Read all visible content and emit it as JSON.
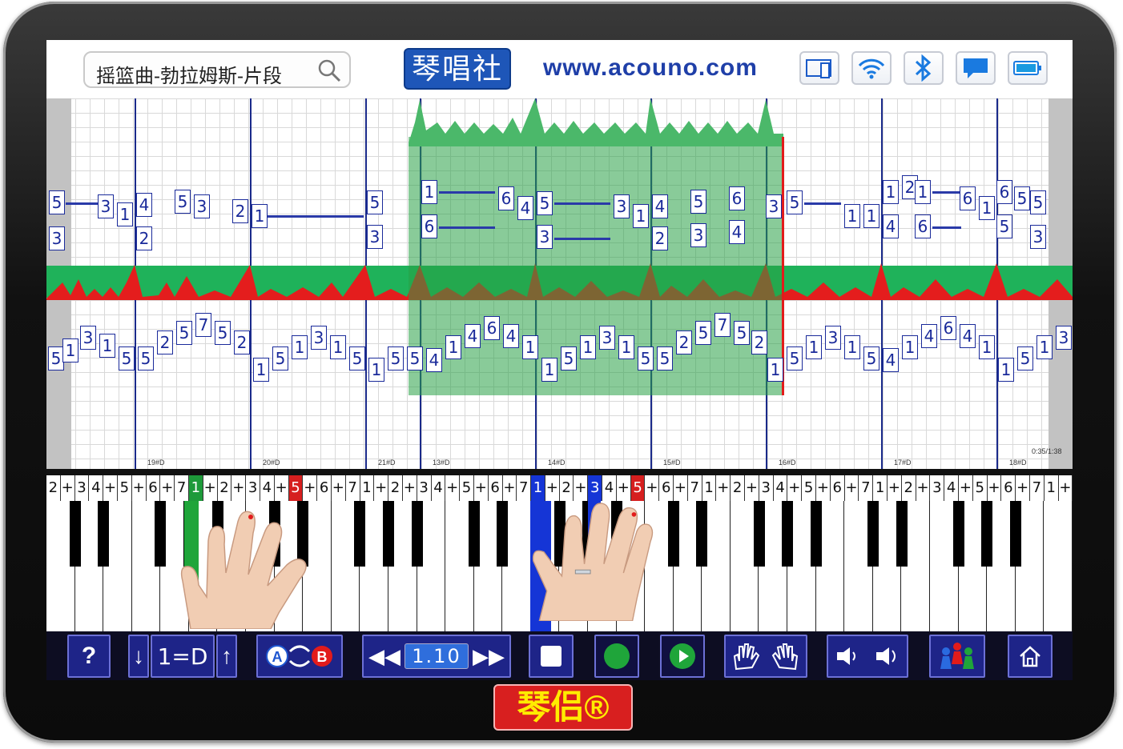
{
  "header": {
    "song_title": "摇篮曲-勃拉姆斯-片段",
    "brand_name": "琴唱社",
    "website": "www.acouno.com",
    "status_icons": [
      "screen-mirror-icon",
      "wifi-icon",
      "bluetooth-icon",
      "message-icon",
      "battery-icon"
    ]
  },
  "score": {
    "measure_labels": [
      "19#D",
      "20#D",
      "21#D",
      "13#D",
      "14#D",
      "15#D",
      "16#D",
      "17#D",
      "18#D"
    ],
    "time_readout": "0:35/1:38",
    "upper_notes": [
      "5",
      "3",
      "3",
      "1",
      "4",
      "2",
      "5",
      "4",
      "3",
      "2",
      "1",
      "5",
      "3",
      "1",
      "1",
      "6",
      "6",
      "4",
      "5",
      "3",
      "3",
      "1",
      "4",
      "2",
      "5",
      "3",
      "6",
      "4",
      "3",
      "5",
      "1",
      "1",
      "1",
      "2",
      "1",
      "6",
      "6",
      "6",
      "4",
      "1",
      "6",
      "5",
      "5",
      "3"
    ],
    "lower_notes": [
      "5",
      "1",
      "3",
      "1",
      "5",
      "5",
      "2",
      "5",
      "7",
      "5",
      "2",
      "1",
      "5",
      "1",
      "3",
      "1",
      "5",
      "1",
      "5",
      "5",
      "4",
      "1",
      "4",
      "6",
      "4",
      "1",
      "1",
      "5",
      "1",
      "3",
      "1",
      "5",
      "5",
      "2",
      "5",
      "7",
      "5",
      "2",
      "1",
      "5",
      "1",
      "3",
      "1",
      "5",
      "4",
      "1",
      "4",
      "6",
      "4",
      "1",
      "1",
      "5",
      "1",
      "3"
    ],
    "accent_colors": {
      "grid_line": "#d9d9d9",
      "note_blue": "#1a2a9a",
      "selection_green": "#28a046",
      "playhead_red": "#e21b1b"
    }
  },
  "keyboard": {
    "number_labels": [
      "2",
      "+",
      "3",
      "4",
      "+",
      "5",
      "+",
      "6",
      "+",
      "7",
      "1",
      "+",
      "2",
      "+",
      "3",
      "4",
      "+",
      "5",
      "+",
      "6",
      "+",
      "7",
      "1",
      "+",
      "2",
      "+",
      "3",
      "4",
      "+",
      "5",
      "+",
      "6",
      "+",
      "7",
      "1",
      "+",
      "2",
      "+",
      "3",
      "4",
      "+",
      "5",
      "+",
      "6",
      "+",
      "7",
      "1",
      "+",
      "2",
      "+",
      "3",
      "4",
      "+",
      "5",
      "+",
      "6",
      "+",
      "7",
      "1",
      "+",
      "2",
      "+",
      "3",
      "4",
      "+",
      "5",
      "+",
      "6",
      "+",
      "7",
      "1",
      "+"
    ]
  },
  "toolbar": {
    "help_label": "?",
    "key_down_label": "↓",
    "key_label": "1=D",
    "key_up_label": "↑",
    "ab_loop_label": "A⟳B",
    "tempo_value": "1.10",
    "rewind_label": "◀◀",
    "forward_label": "▶▶"
  },
  "footer": {
    "logo_text": "琴侣®"
  }
}
